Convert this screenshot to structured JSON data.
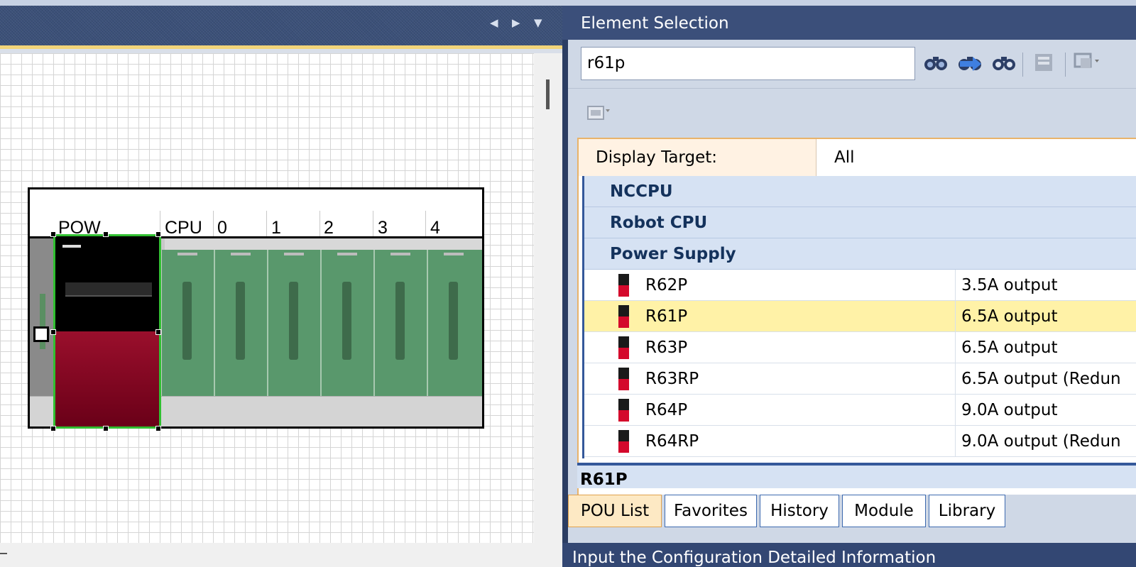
{
  "left_pane": {
    "nav_prev": "◀",
    "nav_next": "▶",
    "nav_menu": "▼",
    "rack": {
      "slot_labels": [
        "POW",
        "CPU",
        "0",
        "1",
        "2",
        "3",
        "4"
      ]
    }
  },
  "element_selection": {
    "title": "Element Selection",
    "search": {
      "value": "r61p"
    },
    "toolbar_icons": [
      "find-icon",
      "find-next-icon",
      "find-all-icon",
      "module-icon",
      "display-icon"
    ],
    "display_target": {
      "label": "Display Target:",
      "value": "All"
    },
    "categories": [
      {
        "label": "NCCPU"
      },
      {
        "label": "Robot CPU"
      },
      {
        "label": "Power Supply"
      }
    ],
    "items": [
      {
        "name": "R62P",
        "desc": "3.5A output",
        "selected": false
      },
      {
        "name": "R61P",
        "desc": "6.5A output",
        "selected": true
      },
      {
        "name": "R63P",
        "desc": "6.5A output",
        "selected": false
      },
      {
        "name": "R63RP",
        "desc": "6.5A output (Redun",
        "selected": false
      },
      {
        "name": "R64P",
        "desc": "9.0A output",
        "selected": false
      },
      {
        "name": "R64RP",
        "desc": "9.0A output (Redun",
        "selected": false
      }
    ],
    "detail_title": "R61P",
    "tabs": [
      "POU List",
      "Favorites",
      "History",
      "Module",
      "Library"
    ],
    "active_tab": "POU List"
  },
  "bottom_status": "Input the Configuration Detailed Information"
}
